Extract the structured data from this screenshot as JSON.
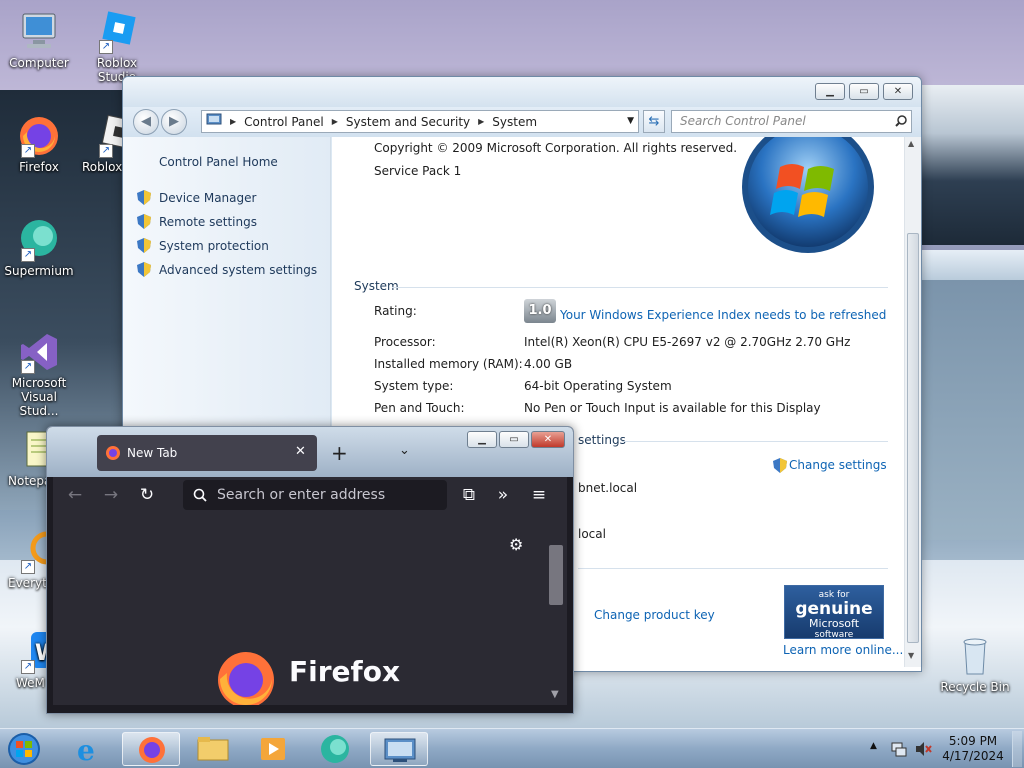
{
  "desktop": {
    "icons": [
      {
        "label": "Computer"
      },
      {
        "label": "Roblox Studio"
      },
      {
        "label": "Firefox"
      },
      {
        "label": "Roblox I"
      },
      {
        "label": "Supermium"
      },
      {
        "label": "Microsoft Visual Stud..."
      },
      {
        "label": "Notepa"
      },
      {
        "label": "Everyth"
      },
      {
        "label": "WeM"
      },
      {
        "label": "Recycle Bin"
      }
    ]
  },
  "control_panel": {
    "address": {
      "crumbs": [
        "Control Panel",
        "System and Security",
        "System"
      ]
    },
    "search_placeholder": "Search Control Panel",
    "sidebar": {
      "home": "Control Panel Home",
      "links": [
        "Device Manager",
        "Remote settings",
        "System protection",
        "Advanced system settings"
      ]
    },
    "edition": {
      "copyright": "Copyright © 2009 Microsoft Corporation.  All rights reserved.",
      "service_pack": "Service Pack 1"
    },
    "system_section": {
      "heading": "System",
      "rating_label": "Rating:",
      "rating_value": "1.0",
      "rating_link": "Your Windows Experience Index needs to be refreshed",
      "processor_label": "Processor:",
      "processor_value": "Intel(R) Xeon(R) CPU E5-2697 v2 @ 2.70GHz   2.70 GHz",
      "memory_label": "Installed memory (RAM):",
      "memory_value": "4.00 GB",
      "type_label": "System type:",
      "type_value": "64-bit Operating System",
      "pen_label": "Pen and Touch:",
      "pen_value": "No Pen or Touch Input is available for this Display"
    },
    "computer_section": {
      "heading_fragment": "settings",
      "change_settings": "Change settings",
      "domain_fragment_1": "bnet.local",
      "domain_fragment_2": "local"
    },
    "activation": {
      "change_key": "Change product key",
      "genuine_line1": "ask for",
      "genuine_line2": "genuine",
      "genuine_line3": "Microsoft",
      "genuine_line4": "software",
      "learn_more": "Learn more online..."
    }
  },
  "firefox": {
    "tab_title": "New Tab",
    "url_placeholder": "Search or enter address",
    "brand": "Firefox"
  },
  "taskbar": {
    "time": "5:09 PM",
    "date": "4/17/2024"
  }
}
